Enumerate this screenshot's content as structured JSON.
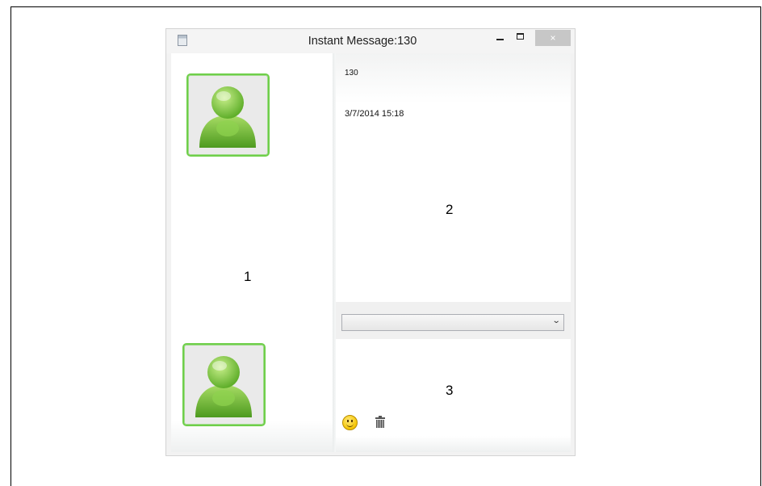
{
  "window": {
    "title": "Instant Message:130",
    "close_glyph": "×"
  },
  "conversation": {
    "contact": "130",
    "timestamp": "3/7/2014 15:18"
  },
  "annotations": {
    "region_1": "1",
    "region_2": "2",
    "region_3": "3"
  },
  "composer": {
    "font_select_value": "",
    "chevron_glyph": "⌄"
  },
  "icons": {
    "app": "window-icon",
    "remote_avatar": "user-avatar-icon",
    "local_avatar": "user-avatar-icon",
    "emoticon": "smiley-icon",
    "clear": "trash-icon"
  },
  "colors": {
    "avatar_border": "#6fcf4a",
    "avatar_figure": "#7dc242"
  }
}
